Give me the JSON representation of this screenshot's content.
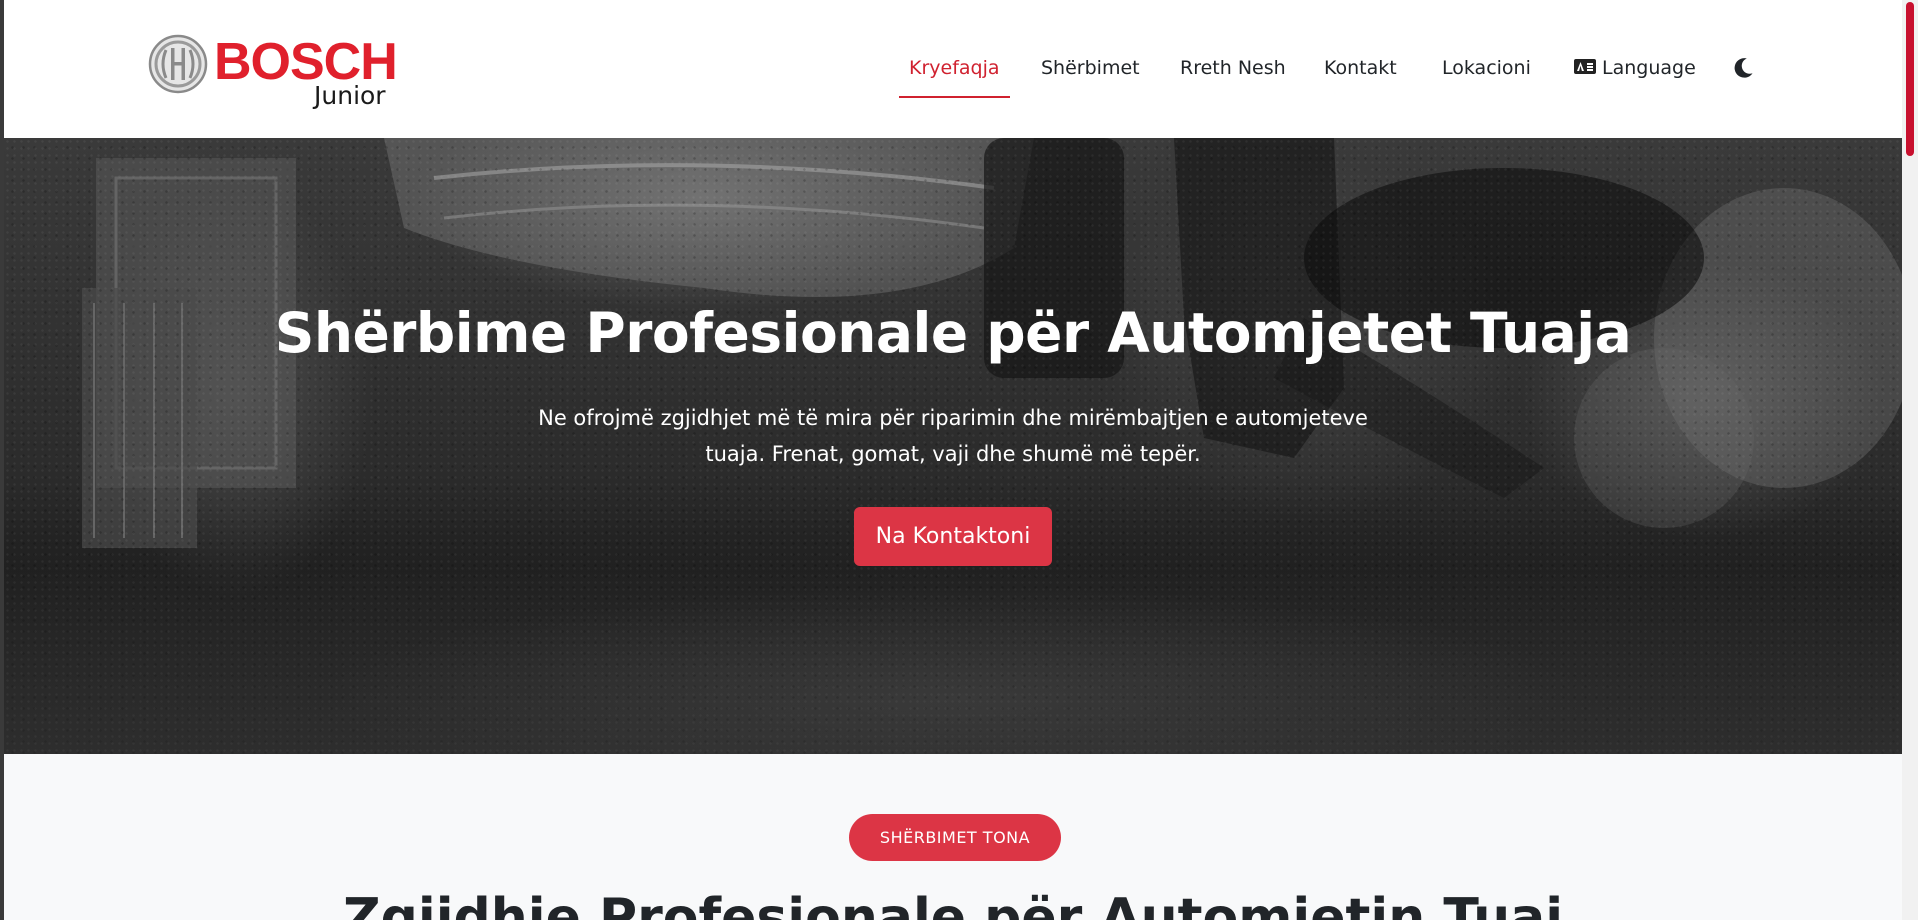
{
  "brand": {
    "name": "BOSCH",
    "sub": "Junior",
    "color": "#e0202c"
  },
  "nav": {
    "items": [
      {
        "label": "Kryefaqja",
        "active": true
      },
      {
        "label": "Shërbimet",
        "active": false
      },
      {
        "label": "Rreth Nesh",
        "active": false
      },
      {
        "label": "Kontakt",
        "active": false
      },
      {
        "label": "Lokacioni",
        "active": false
      },
      {
        "label": "Language",
        "active": false,
        "icon": "language-card-icon"
      }
    ],
    "theme_toggle_icon": "moon-icon",
    "active_color": "#d0212f"
  },
  "hero": {
    "title": "Shërbime Profesionale për Automjetet Tuaja",
    "text": "Ne ofrojmë zgjidhjet më të mira për riparimin dhe mirëmbajtjen e automjeteve tuaja. Frenat, gomat, vaji dhe shumë më tepër.",
    "button_label": "Na Kontaktoni",
    "button_color": "#dc3545"
  },
  "services": {
    "badge": "SHËRBIMET TONA",
    "title": "Zgjidhje Profesionale për Automjetin Tuaj"
  },
  "scrollbar": {
    "thumb_color": "#c8102e"
  }
}
